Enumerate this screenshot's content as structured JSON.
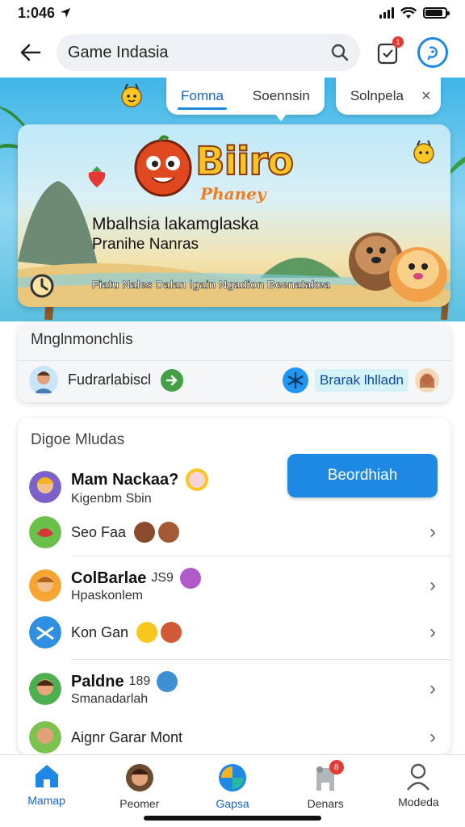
{
  "status_bar": {
    "time": "1:046"
  },
  "header": {
    "search_value": "Game Indasia",
    "notification_count": "1"
  },
  "hero": {
    "tabs": [
      {
        "label": "Fomna",
        "active": true
      },
      {
        "label": "Soennsin",
        "active": false
      },
      {
        "label": "Solnpela",
        "active": false
      }
    ],
    "close_label": "×",
    "banner": {
      "logo_text": "Biiro",
      "logo_sub": "Phaney",
      "title": "Mbalhsia lakamglaska",
      "subtitle": "Pranihe Nanras",
      "footer": "Fiatu Nales Dalan lgain Ngadion Beenatakea"
    }
  },
  "quick": {
    "title": "Mnglnmonchlis",
    "link_label": "Fudrarlabiscl",
    "right_label": "Brarak lhlladn"
  },
  "list": {
    "title": "Digoe Mludas",
    "primary_button": "Beordhiah",
    "rows": [
      {
        "name": "Mam Nackaa?",
        "sub": "Kigenbm Sbin"
      },
      {
        "label": "Seo Faa"
      },
      {
        "name": "ColBarlae",
        "sub": "Hpaskonlem",
        "extra": "JS9"
      },
      {
        "label": "Kon Gan"
      },
      {
        "name": "Paldne",
        "sub": "Smanadarlah",
        "extra": "189"
      },
      {
        "label": "Aignr Garar Mont"
      }
    ]
  },
  "bottom_nav": {
    "items": [
      {
        "label": "Mamap",
        "active": true
      },
      {
        "label": "Peomer",
        "active": false
      },
      {
        "label": "Gapsa",
        "active": false
      },
      {
        "label": "Denars",
        "active": false,
        "badge": "8"
      },
      {
        "label": "Modeda",
        "active": false
      }
    ]
  },
  "colors": {
    "accent": "#1e88e5",
    "success": "#43a047",
    "badge": "#e53935"
  }
}
